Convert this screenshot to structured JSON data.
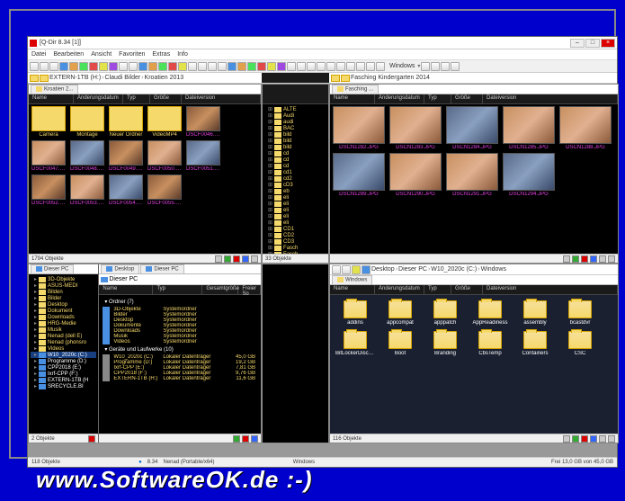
{
  "app": {
    "title": "[Q-Dir 8.34 [1]]"
  },
  "menu": [
    "Datei",
    "Bearbeiten",
    "Ansicht",
    "Favoriten",
    "Extras",
    "Info"
  ],
  "toolbar": {
    "windows_label": "Windows"
  },
  "pane1": {
    "path": [
      "EXTERN-1TB (H:)",
      "Claudi Bilder",
      "Kroatien 2013"
    ],
    "tab": "Kroatien 2...",
    "cols": [
      "Name",
      "Änderungsdatum",
      "Typ",
      "Größe",
      "Dateiversion"
    ],
    "folders": [
      "Camera",
      "Montage",
      "Neuer Ordner",
      "VideoMP4"
    ],
    "photos": [
      "DSCF0046.JPG",
      "DSCF0047.JPG",
      "DSCF0048.JPG",
      "DSCF0049.JPG",
      "DSCF0050.JPG",
      "DSCF0051.JPG",
      "DSCF0052.JPG",
      "DSCF0053.JPG",
      "DSCF0054.JPG",
      "DSCF0055.JPG"
    ],
    "status": "1794 Objekte"
  },
  "pane2": {
    "tree_items": [
      "ALTE",
      "Audi",
      "audi",
      "BAC",
      "bild",
      "bild",
      "bild",
      "cd",
      "cd",
      "cd",
      "cd1",
      "cd2",
      "cD3",
      "eb",
      "eli",
      "eli",
      "eli",
      "eli",
      "eli",
      "CD1",
      "CD2",
      "CD3",
      "Fasch",
      "Fasch"
    ],
    "status": "33 Objekte"
  },
  "pane3": {
    "path": [
      "Fasching Kindergarten 2014"
    ],
    "tab": "Fasching ...",
    "cols": [
      "Name",
      "Änderungsdatum",
      "Typ",
      "Größe",
      "Dateiversion"
    ],
    "photos": [
      "DSCN1282.JPG",
      "DSCN1283.JPG",
      "DSCN1284.JPG",
      "DSCN1285.JPG",
      "DSCN1288.JPG",
      "DSCN1289.JPG",
      "DSCN1290.JPG",
      "DSCN1291.JPG",
      "DSCN1294.JPG"
    ]
  },
  "pane4": {
    "tab": "Dieser PC",
    "path": "Dieser PC",
    "tree": [
      "3D-Objekte",
      "ASUS-MEDI",
      "Bilden",
      "Bilder",
      "Desktop",
      "Dokument",
      "Downloads",
      "HRG-Medie",
      "Musik",
      "Nenad (dell E)",
      "Nenad (phonsro",
      "Videos",
      "W10_2020c (C:)",
      "Programme (D:)",
      "CPP2018 (E:)",
      "Ixrf-CPP (F:)",
      "EXTERN-1TB (H",
      "SRECYCLE.BI"
    ],
    "status": "2 Objekte"
  },
  "pane5": {
    "tabs": [
      "Desktop",
      "Dieser PC"
    ],
    "path": "Dieser PC",
    "cols": [
      "Name",
      "Typ",
      "Gesamtgröße",
      "Freier Sp"
    ],
    "hdr1": "Ordner (7)",
    "sys_folders": [
      {
        "n": "3D-Objekte",
        "t": "Systemordner"
      },
      {
        "n": "Bilder",
        "t": "Systemordner"
      },
      {
        "n": "Desktop",
        "t": "Systemordner"
      },
      {
        "n": "Dokumente",
        "t": "Systemordner"
      },
      {
        "n": "Downloads",
        "t": "Systemordner"
      },
      {
        "n": "Musik",
        "t": "Systemordner"
      },
      {
        "n": "Videos",
        "t": "Systemordner"
      }
    ],
    "hdr2": "Geräte und Laufwerke (10)",
    "drives": [
      {
        "n": "W10_2020c (C:)",
        "t": "Lokaler Datenträger",
        "s": "45,0 GB"
      },
      {
        "n": "Programme (D:)",
        "t": "Lokaler Datenträger",
        "s": "19,2 GB"
      },
      {
        "n": "Ixrf-CPP (E:)",
        "t": "Lokaler Datenträger",
        "s": "7,81 GB"
      },
      {
        "n": "CPP2018 (F:)",
        "t": "Lokaler Datenträger",
        "s": "9,76 GB"
      },
      {
        "n": "EXTERN-1TB (H:)",
        "t": "Lokaler Datenträger",
        "s": "11,6 GB"
      }
    ]
  },
  "pane6": {
    "path": [
      "Desktop",
      "Dieser PC",
      "W10_2020c (C:)",
      "Windows"
    ],
    "tab": "Windows",
    "cols": [
      "Name",
      "Änderungsdatum",
      "Typ",
      "Größe",
      "Dateiversion"
    ],
    "folders": [
      "addins",
      "appcompat",
      "apppatch",
      "AppReadiness",
      "assembly",
      "bcastdvr",
      "BitLockerDiscov...",
      "Boot",
      "Branding",
      "CbsTemp",
      "Containers",
      "CSC"
    ],
    "status": "116 Objekte"
  },
  "statusbar": {
    "objects": "118 Objekte",
    "ver": "8.34",
    "user": "Nenad (Portable/x64)",
    "loc": "Windows",
    "free": "Frei 13,0 GB von 45,0 GB"
  },
  "watermark": "www.SoftwareOK.de :-)"
}
